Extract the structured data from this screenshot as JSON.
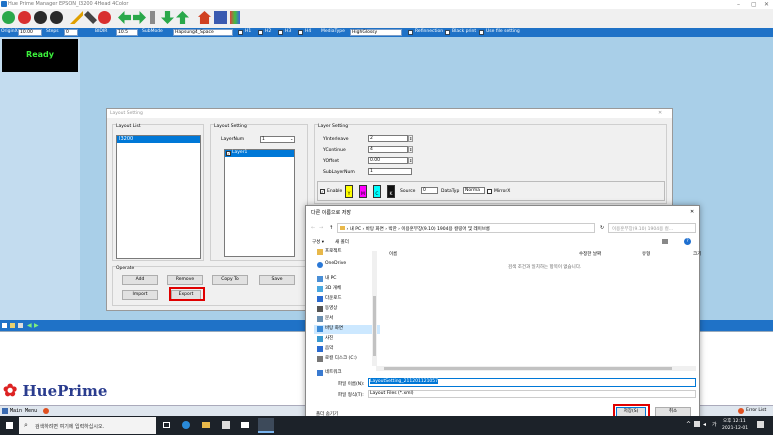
{
  "app": {
    "title": "Hue Prime Manager EPSON_I3200 4Head 4Color"
  },
  "options": {
    "origin_x_label": "OriginX",
    "origin_x": "10.00",
    "steps_label": "Steps",
    "steps": "0",
    "bidir_label": "BIDIR",
    "bidir": "10.5",
    "submode_label": "SubMode",
    "submode": "Hapsung4_Space",
    "h1": "H1",
    "h2": "H2",
    "h3": "H3",
    "h4": "H4",
    "mediatype_label": "MediaType",
    "mediatype": "HighGlossy",
    "reflection": "Refinnection",
    "black_print": "Black print",
    "use_file_setting": "Use file setting"
  },
  "status": {
    "ready": "Ready"
  },
  "logo": {
    "text": "HuePrime"
  },
  "statusbar": {
    "main_menu": "Main Menu",
    "error_list": "Error List"
  },
  "layout_dialog": {
    "title": "Layout Setting",
    "layout_list_label": "Layout List",
    "layout_list_items": [
      "I3200"
    ],
    "layout_setting_label": "Layout Setting",
    "layer_num_label": "LayerNum",
    "layer_num": "1",
    "layers": [
      "Layer1"
    ],
    "layer_setting_label": "Layer Setting",
    "yinterleave_label": "YInterleave",
    "yinterleave": "2",
    "ycontinue_label": "YContinue",
    "ycontinue": "4",
    "yoffset_label": "YOffset",
    "yoffset": "0.00",
    "sublayernum_label": "SubLayerNum",
    "sublayernum": "1",
    "enable_label": "Enable",
    "colors": [
      {
        "letter": "Y",
        "color": "#ffff00"
      },
      {
        "letter": "M",
        "color": "#ff00ff"
      },
      {
        "letter": "C",
        "color": "#00ffff"
      },
      {
        "letter": "K",
        "color": "#111111"
      }
    ],
    "source_label": "Source",
    "source": "0",
    "datatype_label": "DataTyp",
    "datatype": "Norma",
    "mirror_label": "MirrorX",
    "operate_label": "Operate",
    "add": "Add",
    "remove": "Remove",
    "copy_to": "Copy To",
    "save": "Save",
    "import": "Import",
    "export": "Export"
  },
  "save_dialog": {
    "title": "다른 이름으로 저장",
    "path": [
      "내 PC",
      "바탕 화면",
      "박한",
      "이용훈부장(9.10) 1904용 컬링어 및 레이브롱"
    ],
    "search_placeholder": "이용훈부장(9.10) 1904용 컬...",
    "organize": "구성 ▾",
    "new_folder": "새 폴더",
    "col_name": "이름",
    "col_date": "수정한 날짜",
    "col_type": "유형",
    "col_size": "크기",
    "empty_msg": "검색 조건과 일치하는 항목이 없습니다.",
    "sidebar": [
      {
        "label": "프로젝트",
        "icon": "folder-icon",
        "color": "#e8b84a"
      },
      {
        "label": "OneDrive",
        "icon": "cloud-icon",
        "color": "#2a78d6"
      },
      {
        "label": "내 PC",
        "icon": "pc-icon",
        "color": "#4a8fd6"
      },
      {
        "label": "3D 개체",
        "icon": "cube-icon",
        "color": "#4aa8e0"
      },
      {
        "label": "다운로드",
        "icon": "download-icon",
        "color": "#2a6bd0"
      },
      {
        "label": "동영상",
        "icon": "video-icon",
        "color": "#555555"
      },
      {
        "label": "문서",
        "icon": "document-icon",
        "color": "#6a8fb0"
      },
      {
        "label": "바탕 화면",
        "icon": "desktop-icon",
        "color": "#3a8ad8"
      },
      {
        "label": "사진",
        "icon": "picture-icon",
        "color": "#3a9ad0"
      },
      {
        "label": "음악",
        "icon": "music-icon",
        "color": "#2a6bd0"
      },
      {
        "label": "로컬 디스크 (C:)",
        "icon": "disk-icon",
        "color": "#777777"
      },
      {
        "label": "네트워크",
        "icon": "network-icon",
        "color": "#3a7ad0"
      }
    ],
    "filename_label": "파일 이름(N):",
    "filename": "LayoutSetting_211201121057",
    "filetype_label": "파일 형식(T):",
    "filetype": "Layout Files (*.xml)",
    "hide_folders": "폴더 숨기기",
    "save_btn": "저장(S)",
    "cancel_btn": "취소"
  },
  "taskbar": {
    "search_placeholder": "검색하려면 여기에 입력하십시오.",
    "time": "오후 12:11",
    "date": "2021-12-01",
    "lang": "가"
  }
}
